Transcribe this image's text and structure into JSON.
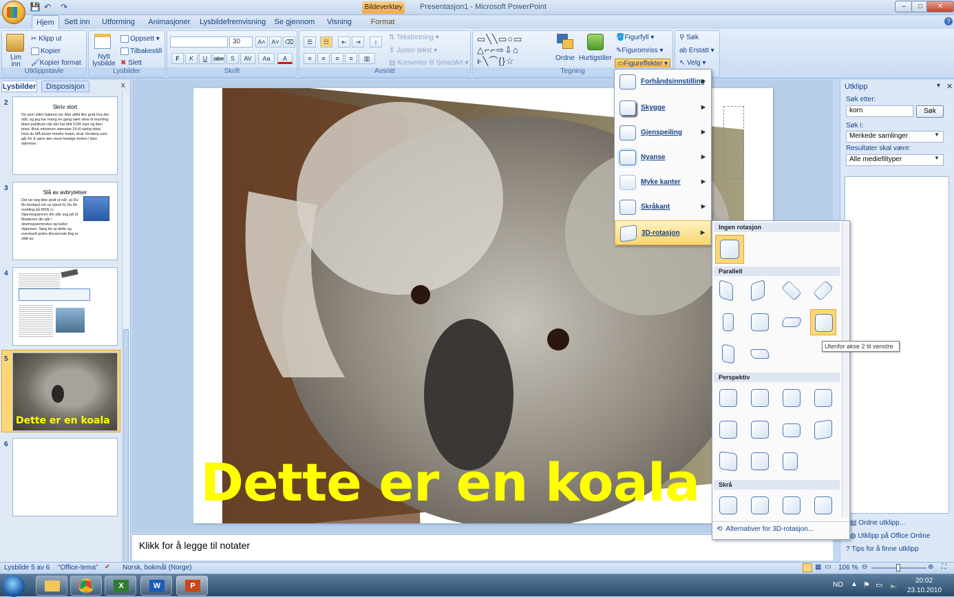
{
  "window": {
    "context_tab": "Bildeverktøy",
    "title": "Presentasjon1 - Microsoft PowerPoint"
  },
  "tabs": [
    "Hjem",
    "Sett inn",
    "Utforming",
    "Animasjoner",
    "Lysbildefremvisning",
    "Se gjennom",
    "Visning",
    "Format"
  ],
  "ribbon": {
    "clipboard": {
      "paste": "Lim inn",
      "cut": "Klipp ut",
      "copy": "Kopier",
      "format_painter": "Kopier format",
      "label": "Utklippstavle"
    },
    "slides": {
      "new": "Nytt lysbilde",
      "layout": "Oppsett",
      "reset": "Tilbakestill",
      "delete": "Slett",
      "label": "Lysbilder"
    },
    "font": {
      "size": "30",
      "bold": "F",
      "italic": "K",
      "underline": "U",
      "strike": "abc",
      "shadow": "S",
      "spacing": "AV",
      "case": "Aa",
      "label": "Skrift"
    },
    "paragraph": {
      "direction": "Tekstretning",
      "align": "Juster tekst",
      "smartart": "Konverter til SmartArt",
      "label": "Avsnitt"
    },
    "drawing": {
      "arrange": "Ordne",
      "quick_styles": "Hurtigstiler",
      "fill": "Figurfyll",
      "outline": "Figuromriss",
      "effects": "Figureffekter",
      "label": "Tegning"
    },
    "editing": {
      "find": "Søk",
      "replace": "Erstatt",
      "select": "Velg"
    }
  },
  "left_pane": {
    "tab_slides": "Lysbilder",
    "tab_outline": "Disposisjon",
    "slides": [
      {
        "num": "2",
        "title": "Skriv stort",
        "body": "De som sitter bakerst ser ikke alltid like godt hva det står, og jeg har mang en gang vært vitne til mumling blant publikum når det har blitt FOR mye og liten tekst. Bruk minimum størrelse 24 til vanlig tekst. Hvis du MÅ bruke mindre fonter, bruk Verdana som går for å være den mest leselige fonten i liten størrelse."
      },
      {
        "num": "3",
        "title": "Slå av avbrytelser",
        "body": "Det tar seg ikke godt ut når: a) Du får beskjed om ny epost b) Du får melding på MSN c) Skjermspareren din slår seg på d) Maskinen din går i strømsparemodus og kutter skjermen. Sørg for at dette og eventuelt andre tilsvarende ting er slått av."
      },
      {
        "num": "4",
        "title": "",
        "body": ""
      },
      {
        "num": "5",
        "title": "Dette er en koala",
        "body": ""
      },
      {
        "num": "6",
        "title": "",
        "body": ""
      }
    ]
  },
  "slide": {
    "caption": "Dette er en koala"
  },
  "notes": {
    "placeholder": "Klikk for å legge til notater"
  },
  "effects_menu": {
    "items": [
      "Forhåndsinnstilling",
      "Skygge",
      "Gjenspeiling",
      "Nyanse",
      "Myke kanter",
      "Skråkant",
      "3D-rotasjon"
    ],
    "selected": "3D-rotasjon"
  },
  "gallery": {
    "sections": [
      "Ingen rotasjon",
      "Parallell",
      "Perspektiv",
      "Skrå"
    ],
    "footer": "Alternativer for 3D-rotasjon...",
    "tooltip": "Utenfor akse 2 til venstre"
  },
  "clip_pane": {
    "title": "Utklipp",
    "search_label": "Søk etter:",
    "search_value": "korn",
    "search_button": "Søk",
    "search_in_label": "Søk i:",
    "search_in_value": "Merkede samlinger",
    "results_label": "Resultater skal være:",
    "results_value": "Alle mediefiltyper",
    "links": [
      "Ordne utklipp...",
      "Utklipp på Office Online",
      "Tips for å finne utklipp"
    ]
  },
  "status": {
    "slide": "Lysbilde 5 av 6",
    "theme": "\"Office-tema\"",
    "language": "Norsk, bokmål (Norge)",
    "zoom": "106 %"
  },
  "taskbar": {
    "lang": "NO",
    "time": "20:02",
    "date": "23.10.2010"
  },
  "colors": {
    "accent": "#fbd778",
    "caption": "#ffff00",
    "ribbon": "#dbe7f6"
  }
}
